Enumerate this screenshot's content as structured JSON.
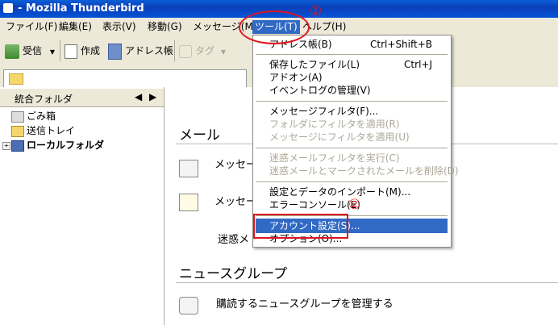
{
  "window": {
    "title": "- Mozilla Thunderbird"
  },
  "menubar": [
    "ファイル(F)",
    "編集(E)",
    "表示(V)",
    "移動(G)",
    "メッセージ(M)",
    "ツール(T)",
    "ヘルプ(H)"
  ],
  "toolbar": {
    "receive": "受信",
    "compose": "作成",
    "addressbook": "アドレス帳",
    "tag": "タグ"
  },
  "folderpane": {
    "header": "統合フォルダ",
    "folders": [
      "ごみ箱",
      "送信トレイ",
      "ローカルフォルダ"
    ]
  },
  "content": {
    "mail_section": "メール",
    "mail_items": [
      "メッセー",
      "メッセー",
      "迷惑メ"
    ],
    "news_section": "ニュースグループ",
    "news_item": "購読するニュースグループを管理する"
  },
  "tools_menu": {
    "items": [
      {
        "label": "アドレス帳(B)",
        "shortcut": "Ctrl+Shift+B",
        "disabled": false
      },
      {
        "label": "保存したファイル(L)",
        "shortcut": "Ctrl+J",
        "disabled": false
      },
      {
        "label": "アドオン(A)",
        "shortcut": "",
        "disabled": false
      },
      {
        "label": "イベントログの管理(V)",
        "shortcut": "",
        "disabled": false
      },
      {
        "label": "メッセージフィルタ(F)...",
        "shortcut": "",
        "disabled": false
      },
      {
        "label": "フォルダにフィルタを適用(R)",
        "shortcut": "",
        "disabled": true
      },
      {
        "label": "メッセージにフィルタを適用(U)",
        "shortcut": "",
        "disabled": true
      },
      {
        "label": "迷惑メールフィルタを実行(C)",
        "shortcut": "",
        "disabled": true
      },
      {
        "label": "迷惑メールとマークされたメールを削除(D)",
        "shortcut": "",
        "disabled": true
      },
      {
        "label": "設定とデータのインポート(M)...",
        "shortcut": "",
        "disabled": false
      },
      {
        "label": "エラーコンソール(E)",
        "shortcut": "",
        "disabled": false
      },
      {
        "label": "アカウント設定(S)...",
        "shortcut": "",
        "disabled": false
      },
      {
        "label": "オプション(O)...",
        "shortcut": "",
        "disabled": false
      }
    ]
  },
  "annotations": {
    "step1": "①",
    "step2": "②"
  },
  "colors": {
    "highlight": "#316ac5",
    "annotation": "#e0141e"
  }
}
